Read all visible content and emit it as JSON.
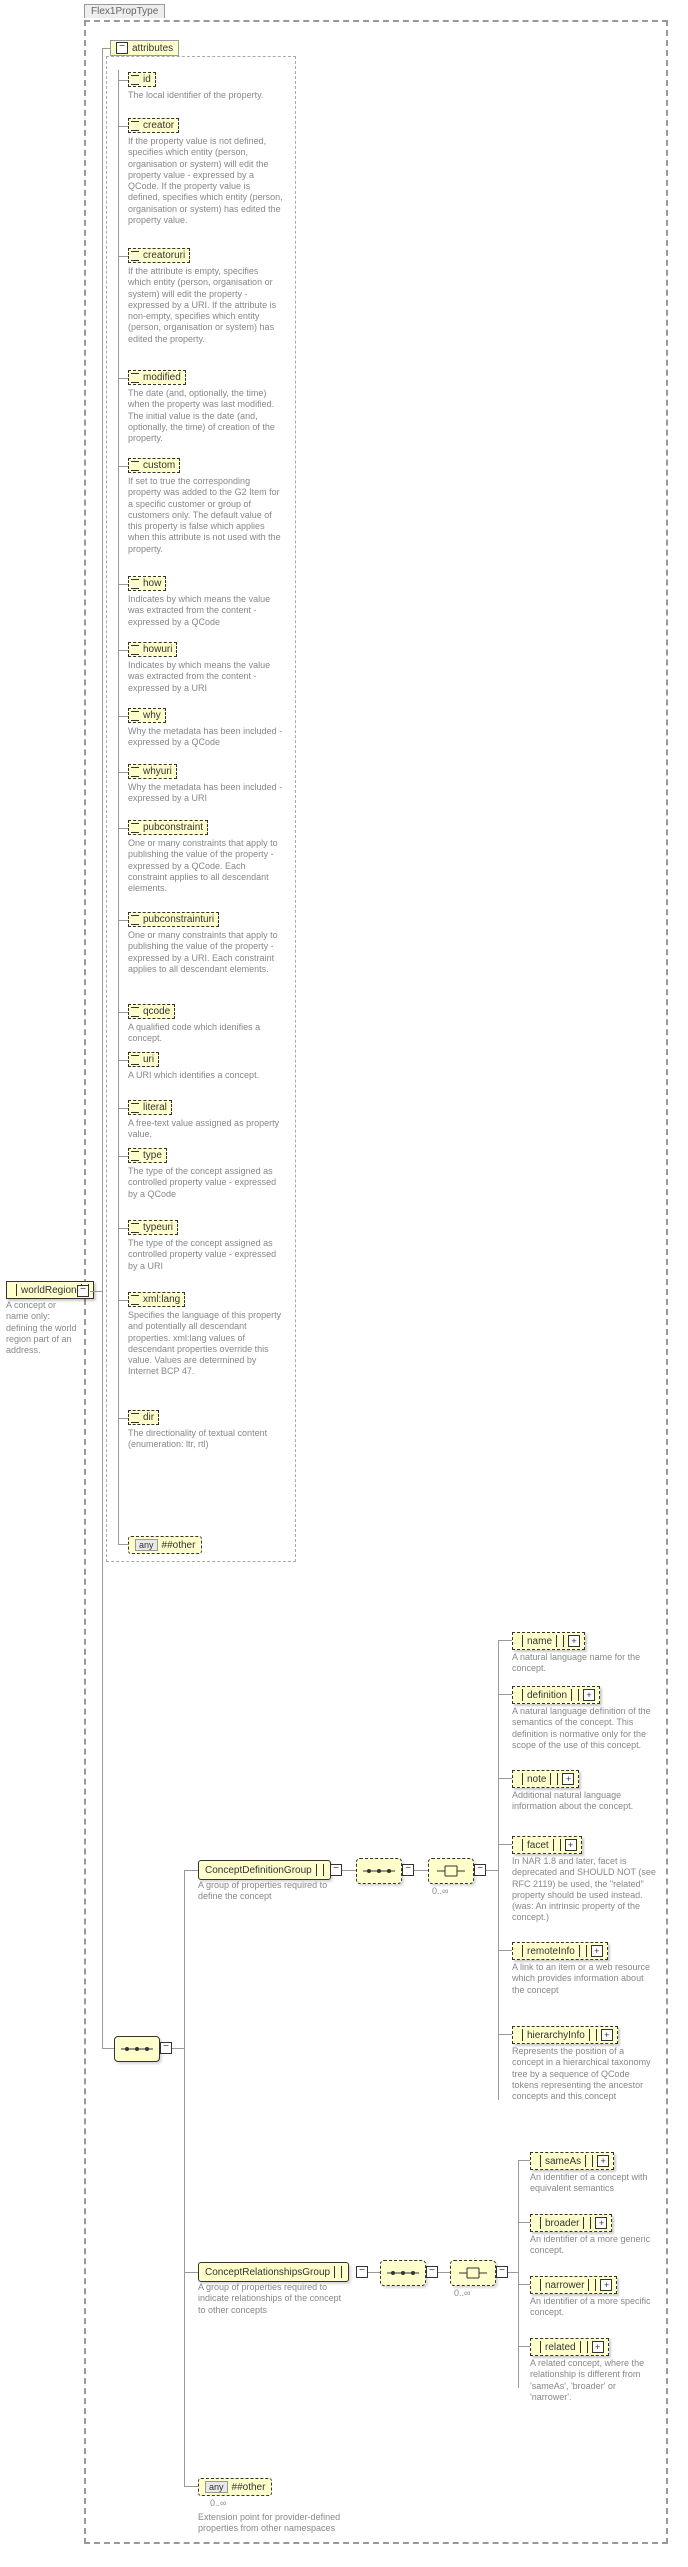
{
  "titleTab": "Flex1PropType",
  "root": {
    "label": "worldRegion",
    "desc": "A concept or name only: defining the world region part of an address."
  },
  "attributes": {
    "header": "attributes",
    "items": [
      {
        "name": "id",
        "desc": "The local identifier of the property."
      },
      {
        "name": "creator",
        "desc": "If the property value is not defined, specifies which entity (person, organisation or system) will edit the property value - expressed by a QCode. If the property value is defined, specifies which entity (person, organisation or system) has edited the property value."
      },
      {
        "name": "creatoruri",
        "desc": "If the attribute is empty, specifies which entity (person, organisation or system) will edit the property - expressed by a URI. If the attribute is non-empty, specifies which entity (person, organisation or system) has edited the property."
      },
      {
        "name": "modified",
        "desc": "The date (and, optionally, the time) when the property was last modified. The initial value is the date (and, optionally, the time) of creation of the property."
      },
      {
        "name": "custom",
        "desc": "If set to true the corresponding property was added to the G2 Item for a specific customer or group of customers only. The default value of this property is false which applies when this attribute is not used with the property."
      },
      {
        "name": "how",
        "desc": "Indicates by which means the value was extracted from the content - expressed by a QCode"
      },
      {
        "name": "howuri",
        "desc": "Indicates by which means the value was extracted from the content - expressed by a URI"
      },
      {
        "name": "why",
        "desc": "Why the metadata has been included - expressed by a QCode"
      },
      {
        "name": "whyuri",
        "desc": "Why the metadata has been included - expressed by a URI"
      },
      {
        "name": "pubconstraint",
        "desc": "One or many constraints that apply to publishing the value of the property - expressed by a QCode. Each constraint applies to all descendant elements."
      },
      {
        "name": "pubconstrainturi",
        "desc": "One or many constraints that apply to publishing the value of the property - expressed by a URI. Each constraint applies to all descendant elements."
      },
      {
        "name": "qcode",
        "desc": "A qualified code which idenifies a concept."
      },
      {
        "name": "uri",
        "desc": "A URI which identifies a concept."
      },
      {
        "name": "literal",
        "desc": "A free-text value assigned as property value."
      },
      {
        "name": "type",
        "desc": "The type of the concept assigned as controlled property value - expressed by a QCode"
      },
      {
        "name": "typeuri",
        "desc": "The type of the concept assigned as controlled property value - expressed by a URI"
      },
      {
        "name": "xml:lang",
        "desc": "Specifies the language of this property and potentially all descendant properties. xml:lang values of descendant properties override this value. Values are determined by Internet BCP 47."
      },
      {
        "name": "dir",
        "desc": "The directionality of textual content (enumeration: ltr, rtl)"
      }
    ],
    "anyOther": {
      "tag": "any",
      "label": "##other"
    }
  },
  "groups": {
    "def": {
      "label": "ConceptDefinitionGroup",
      "desc": "A group of properties required to define the concept",
      "occ": "0..∞",
      "items": [
        {
          "name": "name",
          "desc": "A natural language name for the concept."
        },
        {
          "name": "definition",
          "desc": "A natural language definition of the semantics of the concept. This definition is normative only for the scope of the use of this concept."
        },
        {
          "name": "note",
          "desc": "Additional natural language information about the concept."
        },
        {
          "name": "facet",
          "desc": "In NAR 1.8 and later, facet is deprecated and SHOULD NOT (see RFC 2119) be used, the \"related\" property should be used instead.(was: An intrinsic property of the concept.)"
        },
        {
          "name": "remoteInfo",
          "desc": "A link to an item or a web resource which provides information about the concept"
        },
        {
          "name": "hierarchyInfo",
          "desc": "Represents the position of a concept in a hierarchical taxonomy tree by a sequence of QCode tokens representing the ancestor concepts and this concept"
        }
      ]
    },
    "rel": {
      "label": "ConceptRelationshipsGroup",
      "desc": "A group of properties required to indicate relationships of the concept to other concepts",
      "occ": "0..∞",
      "items": [
        {
          "name": "sameAs",
          "desc": "An identifier of a concept with equivalent semantics"
        },
        {
          "name": "broader",
          "desc": "An identifier of a more generic concept."
        },
        {
          "name": "narrower",
          "desc": "An identifier of a more specific concept."
        },
        {
          "name": "related",
          "desc": "A related concept, where the relationship is different from 'sameAs', 'broader' or 'narrower'."
        }
      ]
    },
    "anyOther": {
      "tag": "any",
      "label": "##other",
      "occ": "0..∞",
      "desc": "Extension point for provider-defined properties from other namespaces"
    }
  },
  "chart_data": {
    "type": "table",
    "title": "Flex1PropType — worldRegion schema diagram",
    "root_element": "worldRegion",
    "root_description": "A concept or name only: defining the world region part of an address.",
    "attributes": [
      "id",
      "creator",
      "creatoruri",
      "modified",
      "custom",
      "how",
      "howuri",
      "why",
      "whyuri",
      "pubconstraint",
      "pubconstrainturi",
      "qcode",
      "uri",
      "literal",
      "type",
      "typeuri",
      "xml:lang",
      "dir",
      "any ##other"
    ],
    "child_groups": [
      {
        "name": "ConceptDefinitionGroup",
        "occurrence": "0..∞",
        "children": [
          "name",
          "definition",
          "note",
          "facet",
          "remoteInfo",
          "hierarchyInfo"
        ]
      },
      {
        "name": "ConceptRelationshipsGroup",
        "occurrence": "0..∞",
        "children": [
          "sameAs",
          "broader",
          "narrower",
          "related"
        ]
      },
      {
        "name": "any ##other",
        "occurrence": "0..∞"
      }
    ]
  }
}
